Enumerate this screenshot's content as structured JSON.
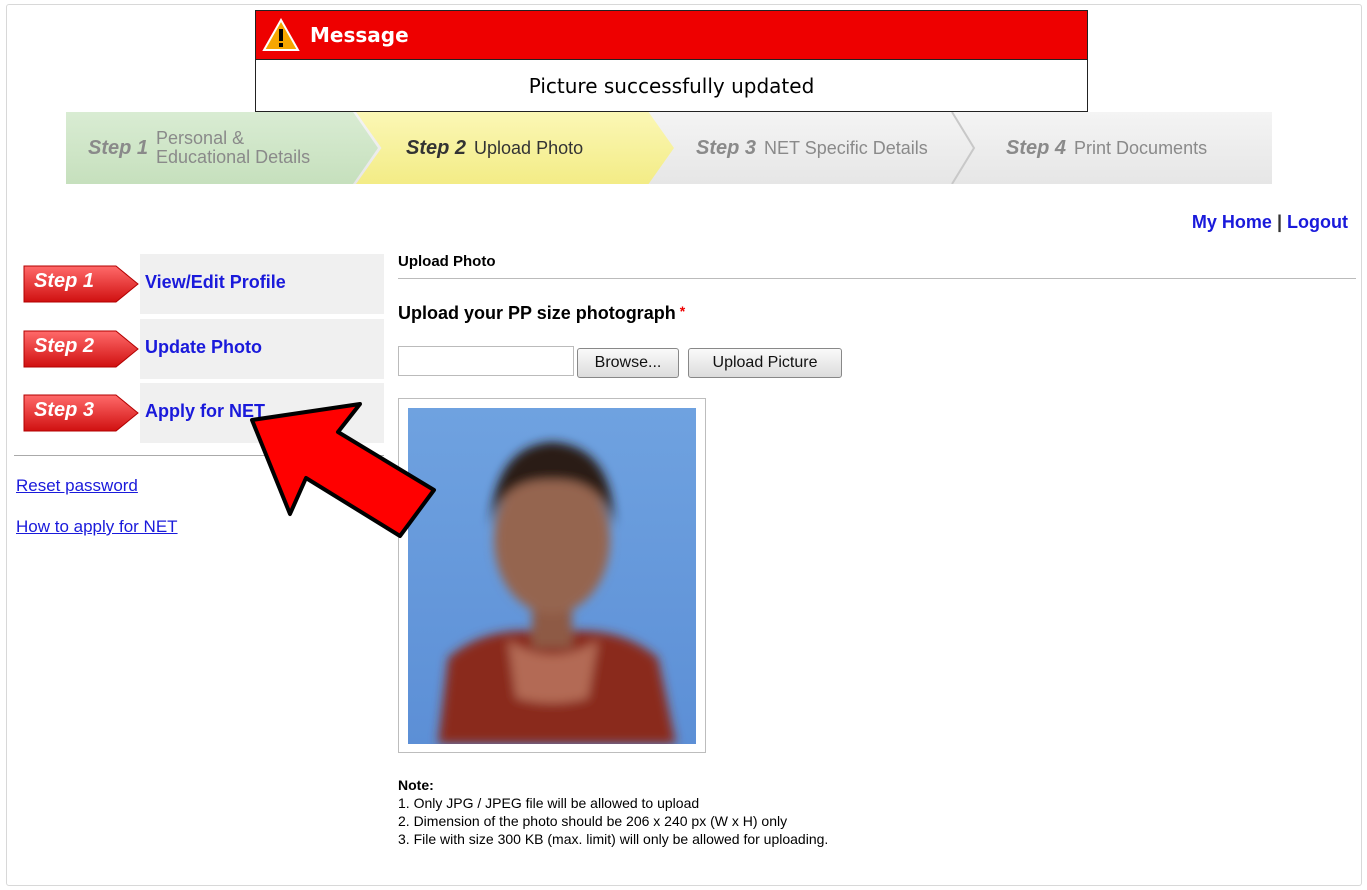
{
  "message": {
    "title": "Message",
    "text": "Picture successfully updated"
  },
  "wizard": [
    {
      "num": "Step 1",
      "label_line1": "Personal &",
      "label_line2": "Educational Details",
      "state": "done"
    },
    {
      "num": "Step 2",
      "label": "Upload Photo",
      "state": "current"
    },
    {
      "num": "Step 3",
      "label": "NET Specific Details",
      "state": "pending"
    },
    {
      "num": "Step 4",
      "label": "Print Documents",
      "state": "pending"
    }
  ],
  "toplinks": {
    "home": "My Home",
    "separator": "|",
    "logout": "Logout"
  },
  "sidebar": {
    "steps": [
      {
        "badge": "Step 1",
        "label": "View/Edit Profile"
      },
      {
        "badge": "Step 2",
        "label": "Update Photo"
      },
      {
        "badge": "Step 3",
        "label": "Apply for NET"
      }
    ],
    "links": [
      {
        "label": "Reset password"
      },
      {
        "label": "How to apply for NET"
      }
    ]
  },
  "main": {
    "section_title": "Upload Photo",
    "field_label": "Upload your PP size photograph",
    "required_mark": "*",
    "browse_label": "Browse...",
    "upload_label": "Upload Picture",
    "notes_title": "Note:",
    "notes": [
      "1. Only JPG / JPEG file will be allowed to upload",
      "2. Dimension of the photo should be 206 x 240 px (W x H) only",
      "3. File with size 300 KB (max. limit) will only be allowed for uploading."
    ]
  },
  "colors": {
    "message_header": "#ee0000",
    "link": "#1a1adb",
    "step_badge": "#e02020",
    "annotation_arrow": "#ff0000"
  }
}
